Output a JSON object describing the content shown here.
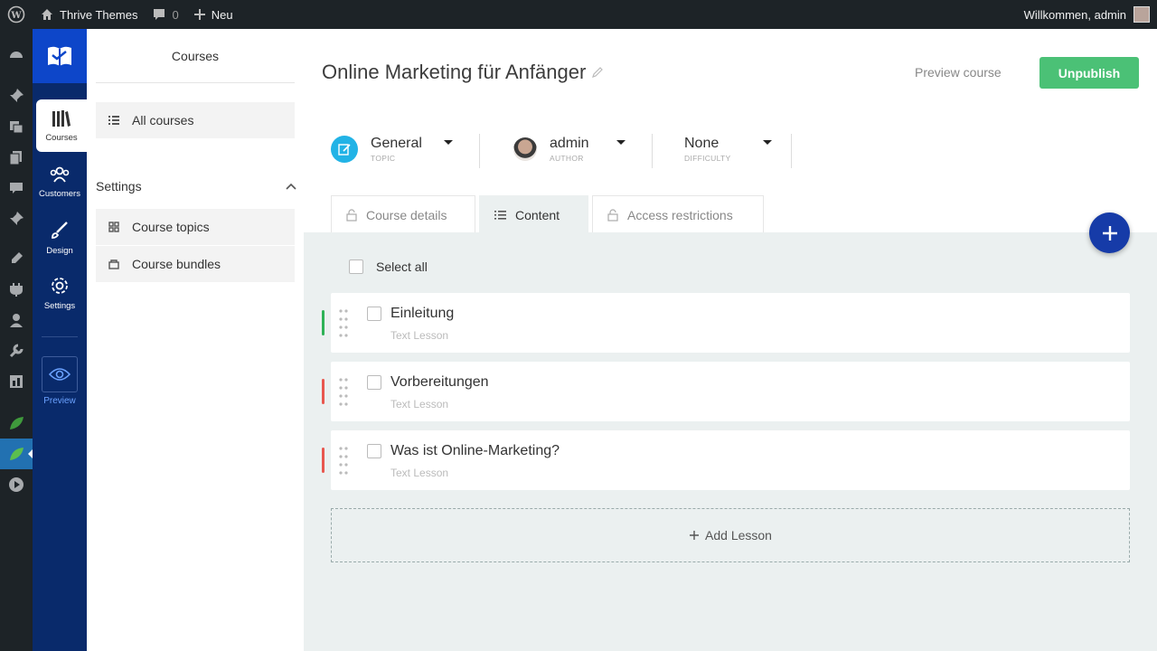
{
  "adminbar": {
    "site_name": "Thrive Themes",
    "comments_count": "0",
    "new_label": "Neu",
    "welcome": "Willkommen, admin"
  },
  "thrive_nav": {
    "items": [
      {
        "label": "Courses",
        "icon": "books-icon"
      },
      {
        "label": "Customers",
        "icon": "users-icon"
      },
      {
        "label": "Design",
        "icon": "brush-icon"
      },
      {
        "label": "Settings",
        "icon": "gear-icon"
      }
    ],
    "preview_label": "Preview"
  },
  "panel": {
    "header": "Courses",
    "all_courses": "All courses",
    "settings_heading": "Settings",
    "settings_items": [
      "Course topics",
      "Course bundles"
    ]
  },
  "course": {
    "title": "Online Marketing für Anfänger",
    "preview_label": "Preview course",
    "unpublish_label": "Unpublish",
    "meta": [
      {
        "value": "General",
        "label": "TOPIC"
      },
      {
        "value": "admin",
        "label": "AUTHOR"
      },
      {
        "value": "None",
        "label": "DIFFICULTY"
      }
    ],
    "tabs": [
      {
        "label": "Course details",
        "icon": "lock-icon"
      },
      {
        "label": "Content",
        "icon": "list-icon"
      },
      {
        "label": "Access restrictions",
        "icon": "lock-icon"
      }
    ],
    "active_tab": "Content"
  },
  "content": {
    "select_all": "Select all",
    "lessons": [
      {
        "title": "Einleitung",
        "type": "Text Lesson",
        "status_color": "#2eb257"
      },
      {
        "title": "Vorbereitungen",
        "type": "Text Lesson",
        "status_color": "#e8574f"
      },
      {
        "title": "Was ist Online-Marketing?",
        "type": "Text Lesson",
        "status_color": "#e8574f"
      }
    ],
    "add_lesson": "Add Lesson"
  },
  "colors": {
    "accent": "#0d46c9",
    "sidebar": "#092a6b",
    "unpublish": "#4bc176",
    "fab": "#163ba8"
  }
}
